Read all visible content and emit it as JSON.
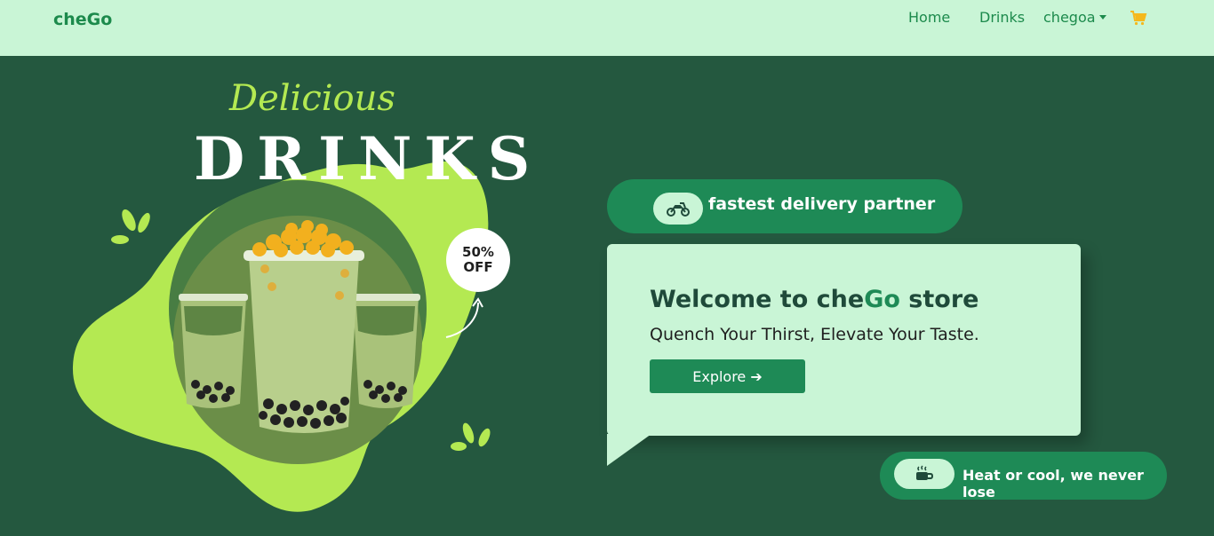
{
  "nav": {
    "brand": "cheGo",
    "links": {
      "home": "Home",
      "drinks": "Drinks",
      "user": "chegoa"
    },
    "cart_icon": "shopping-cart-icon"
  },
  "hero": {
    "title_script": "Delicious",
    "title_big": "DRINKS",
    "badge_line1": "50%",
    "badge_line2": "OFF"
  },
  "delivery": {
    "icon": "motorcycle-icon",
    "label": "fastest delivery partner"
  },
  "card": {
    "welcome_pre": "Welcome to che",
    "welcome_accent": "Go",
    "welcome_post": " store",
    "tagline": "Quench Your Thirst, Elevate Your Taste.",
    "button": "Explore ➔"
  },
  "heat": {
    "icon": "coffee-cup-icon",
    "label": "Heat or cool, we never lose"
  },
  "colors": {
    "nav_bg": "#c9f5d6",
    "hero_bg": "#24583f",
    "accent_green": "#1e8a56",
    "lime": "#b4e952",
    "cart": "#f5b81c"
  }
}
